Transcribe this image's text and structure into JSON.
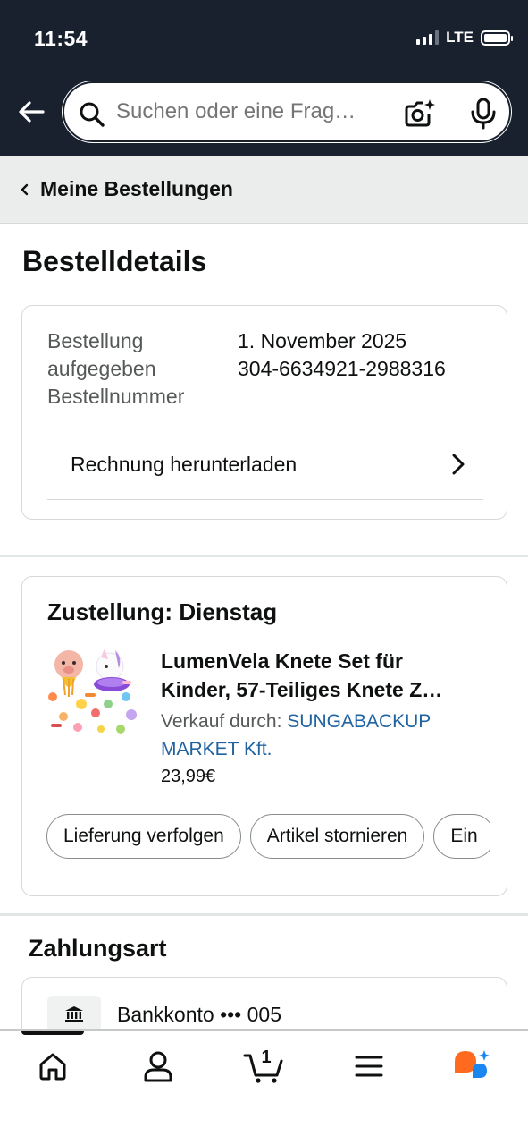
{
  "status_bar": {
    "time": "11:54",
    "network": "LTE"
  },
  "search": {
    "placeholder": "Suchen oder eine Frag…"
  },
  "breadcrumb": {
    "label": "Meine Bestellungen"
  },
  "page": {
    "title": "Bestelldetails"
  },
  "order_info": {
    "placed_label_line1": "Bestellung",
    "placed_label_line2": "aufgegeben",
    "number_label": "Bestellnummer",
    "placed_value": "1. November 2025",
    "number_value": "304-6634921-2988316",
    "invoice_label": "Rechnung herunterladen"
  },
  "delivery": {
    "title": "Zustellung: Dienstag",
    "product": {
      "title_line1": "LumenVela Knete Set für",
      "title_line2": "Kinder, 57-Teiliges Knete Z…",
      "seller_prefix": "Verkauf durch:",
      "seller_name": "SUNGABACKUP MARKET Kft.",
      "price": "23,99€"
    },
    "actions": [
      "Lieferung verfolgen",
      "Artikel stornieren",
      "Ein"
    ]
  },
  "payment": {
    "title": "Zahlungsart",
    "method": "Bankkonto ••• 005"
  },
  "bottom_nav": {
    "cart_count": "1",
    "items": [
      "home-icon",
      "account-icon",
      "cart-icon",
      "menu-icon",
      "rufus-icon"
    ]
  },
  "colors": {
    "header_bg": "#19212f",
    "link": "#2162a1",
    "breadcrumb_bg": "#ebeded",
    "rufus_orange": "#ff6a1f",
    "rufus_blue": "#1a86f0"
  }
}
